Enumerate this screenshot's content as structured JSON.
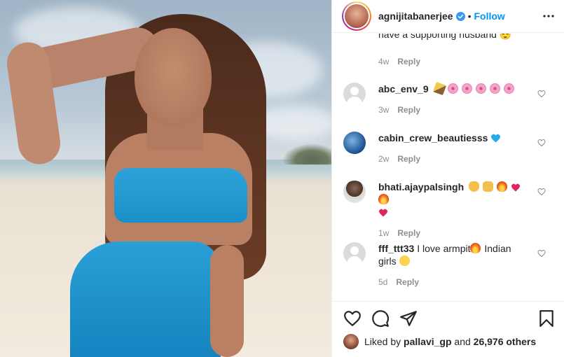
{
  "header": {
    "username": "agnijitabanerjee",
    "separator": "•",
    "follow_label": "Follow"
  },
  "comments": {
    "top_partial": {
      "text": "have a supporting husband 😌",
      "time": "4w",
      "reply_label": "Reply"
    },
    "items": [
      {
        "username": "abc_env_9",
        "text": "",
        "time": "3w",
        "reply_label": "Reply",
        "avatar": "default-avatar-icon"
      },
      {
        "username": "cabin_crew_beautiesss",
        "text": "",
        "time": "2w",
        "reply_label": "Reply",
        "avatar": "profile-photo"
      },
      {
        "username": "bhati.ajaypalsingh",
        "text": "",
        "time": "1w",
        "reply_label": "Reply",
        "avatar": "profile-photo"
      },
      {
        "username": "fff_ttt33",
        "text": " I love armpit",
        "text2": " Indian girls",
        "time": "5d",
        "reply_label": "Reply",
        "avatar": "default-avatar-icon"
      }
    ]
  },
  "likes": {
    "prefix": "Liked by",
    "user": "pallavi_gp",
    "middle": "and",
    "count": "26,976 others"
  },
  "colors": {
    "accent": "#0095f6",
    "muted": "#8e8e8e",
    "text": "#262626"
  }
}
